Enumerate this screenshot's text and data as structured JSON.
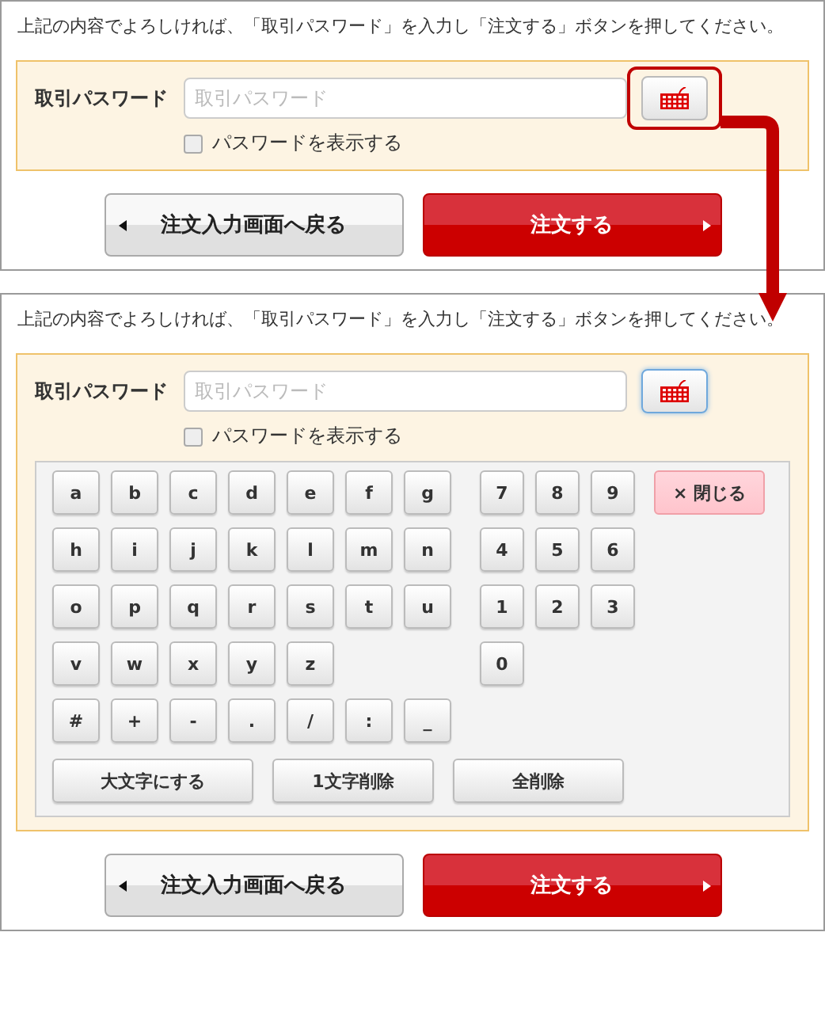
{
  "screens": [
    {
      "instruction": "上記の内容でよろしければ、「取引パスワード」を入力し「注文する」ボタンを押してください。",
      "password": {
        "label": "取引パスワード",
        "placeholder": "取引パスワード"
      },
      "keyboard_button": {
        "highlighted": true,
        "active": false
      },
      "show_password": {
        "label": "パスワードを表示する",
        "checked": false
      },
      "buttons": [
        {
          "kind": "back",
          "label": "注文入力画面へ戻る"
        },
        {
          "kind": "submit",
          "label": "注文する"
        }
      ]
    },
    {
      "instruction": "上記の内容でよろしければ、「取引パスワード」を入力し「注文する」ボタンを押してください。",
      "password": {
        "label": "取引パスワード",
        "placeholder": "取引パスワード"
      },
      "keyboard_button": {
        "highlighted": false,
        "active": true
      },
      "show_password": {
        "label": "パスワードを表示する",
        "checked": false
      },
      "keyboard": {
        "letter_rows": [
          [
            "a",
            "b",
            "c",
            "d",
            "e",
            "f",
            "g"
          ],
          [
            "h",
            "i",
            "j",
            "k",
            "l",
            "m",
            "n"
          ],
          [
            "o",
            "p",
            "q",
            "r",
            "s",
            "t",
            "u"
          ],
          [
            "v",
            "w",
            "x",
            "y",
            "z"
          ],
          [
            "#",
            "+",
            "-",
            ".",
            "/",
            ":",
            "_"
          ]
        ],
        "digit_rows": [
          [
            "7",
            "8",
            "9"
          ],
          [
            "4",
            "5",
            "6"
          ],
          [
            "1",
            "2",
            "3"
          ],
          [
            "0"
          ]
        ],
        "close": "× 閉じる",
        "actions": [
          "大文字にする",
          "1文字削除",
          "全削除"
        ]
      },
      "buttons": [
        {
          "kind": "back",
          "label": "注文入力画面へ戻る"
        },
        {
          "kind": "submit",
          "label": "注文する"
        }
      ]
    }
  ]
}
